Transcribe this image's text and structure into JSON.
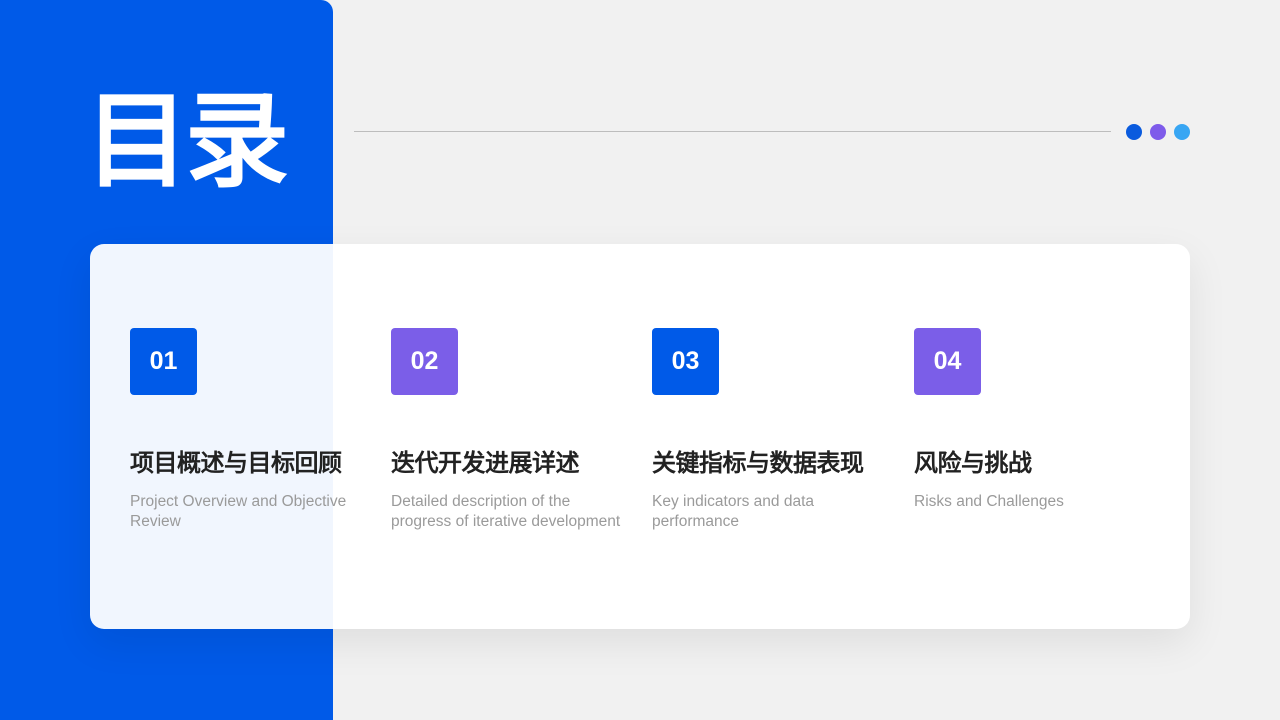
{
  "title": "目录",
  "dots": [
    {
      "name": "dot-blue",
      "color": "#0a5bde"
    },
    {
      "name": "dot-purple",
      "color": "#7e5bea"
    },
    {
      "name": "dot-lightblue",
      "color": "#38a6f3"
    }
  ],
  "items": [
    {
      "number": "01",
      "title": "项目概述与目标回顾",
      "subtitle": "Project Overview and Objective Review",
      "color": "#005ae8"
    },
    {
      "number": "02",
      "title": "迭代开发进展详述",
      "subtitle": "Detailed description of the progress of iterative development",
      "color": "#7b5ee8"
    },
    {
      "number": "03",
      "title": "关键指标与数据表现",
      "subtitle": "Key indicators and data performance",
      "color": "#005ae8"
    },
    {
      "number": "04",
      "title": "风险与挑战",
      "subtitle": "Risks and Challenges",
      "color": "#7b5ee8"
    }
  ]
}
